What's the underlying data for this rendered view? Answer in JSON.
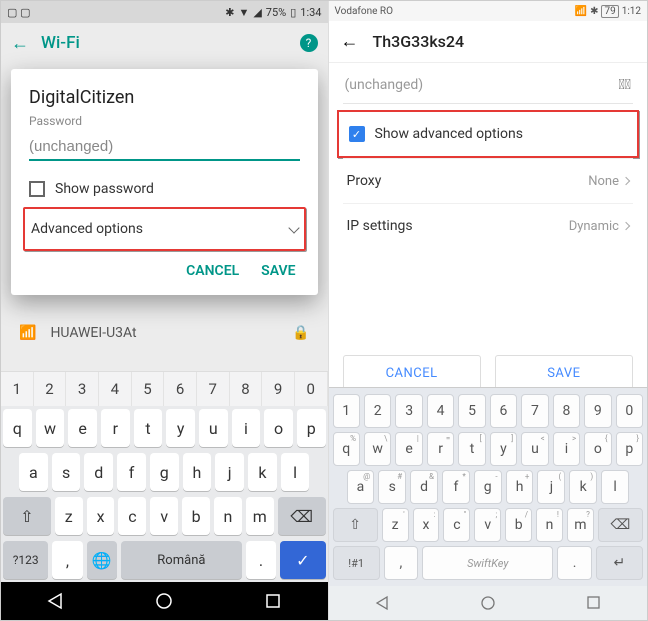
{
  "left": {
    "status": {
      "battery": "75%",
      "time": "1:34"
    },
    "appbar": {
      "title": "Wi-Fi"
    },
    "bg_network": "HUAWEI-U3At",
    "dialog": {
      "ssid": "DigitalCitizen",
      "password_label": "Password",
      "password_value": "(unchanged)",
      "show_password": "Show password",
      "advanced": "Advanced options",
      "cancel": "CANCEL",
      "save": "SAVE"
    },
    "keyboard": {
      "nums": [
        "1",
        "2",
        "3",
        "4",
        "5",
        "6",
        "7",
        "8",
        "9",
        "0"
      ],
      "r1": [
        "q",
        "w",
        "e",
        "r",
        "t",
        "y",
        "u",
        "i",
        "o",
        "p"
      ],
      "r2": [
        "a",
        "s",
        "d",
        "f",
        "g",
        "h",
        "j",
        "k",
        "l"
      ],
      "r3": [
        "z",
        "x",
        "c",
        "v",
        "b",
        "n",
        "m"
      ],
      "shift": "⇧",
      "back": "⌫",
      "sym": "?123",
      "comma": ",",
      "globe": "🌐",
      "space": "Română",
      "period": ".",
      "enter": "✓"
    }
  },
  "right": {
    "status": {
      "carrier": "Vodafone RO",
      "time": "1:12",
      "battery": "79"
    },
    "appbar": {
      "title": "Th3G33ks24"
    },
    "password_value": "(unchanged)",
    "advanced_label": "Show advanced options",
    "proxy": {
      "label": "Proxy",
      "value": "None"
    },
    "ip": {
      "label": "IP settings",
      "value": "Dynamic"
    },
    "cancel": "CANCEL",
    "save": "SAVE",
    "keyboard": {
      "nums": [
        "1",
        "2",
        "3",
        "4",
        "5",
        "6",
        "7",
        "8",
        "9",
        "0"
      ],
      "r1": [
        [
          "q",
          "%"
        ],
        [
          "w",
          "\\"
        ],
        [
          "e",
          "|"
        ],
        [
          "r",
          "="
        ],
        [
          "t",
          "["
        ],
        [
          "y",
          "]"
        ],
        [
          "u",
          "<"
        ],
        [
          "i",
          ">"
        ],
        [
          "o",
          "{"
        ],
        [
          "p",
          "}"
        ]
      ],
      "r2": [
        [
          "a",
          "@"
        ],
        [
          "s",
          "#"
        ],
        [
          "d",
          "&"
        ],
        [
          "f",
          "*"
        ],
        [
          "g",
          "-"
        ],
        [
          "h",
          "+"
        ],
        [
          "j",
          "("
        ],
        [
          "k",
          ")"
        ],
        [
          "l",
          ""
        ]
      ],
      "r3": [
        [
          "z",
          "'"
        ],
        [
          "x",
          ":"
        ],
        [
          "c",
          "\""
        ],
        [
          "v",
          ";"
        ],
        [
          "b",
          "/"
        ],
        [
          "n",
          "!"
        ],
        [
          "m",
          "?"
        ]
      ],
      "shift": "⇧",
      "back": "⌫",
      "sym1": "!#1",
      "comma": ",",
      "space": "SwiftKey",
      "period": ".",
      "enter": "↵"
    }
  }
}
